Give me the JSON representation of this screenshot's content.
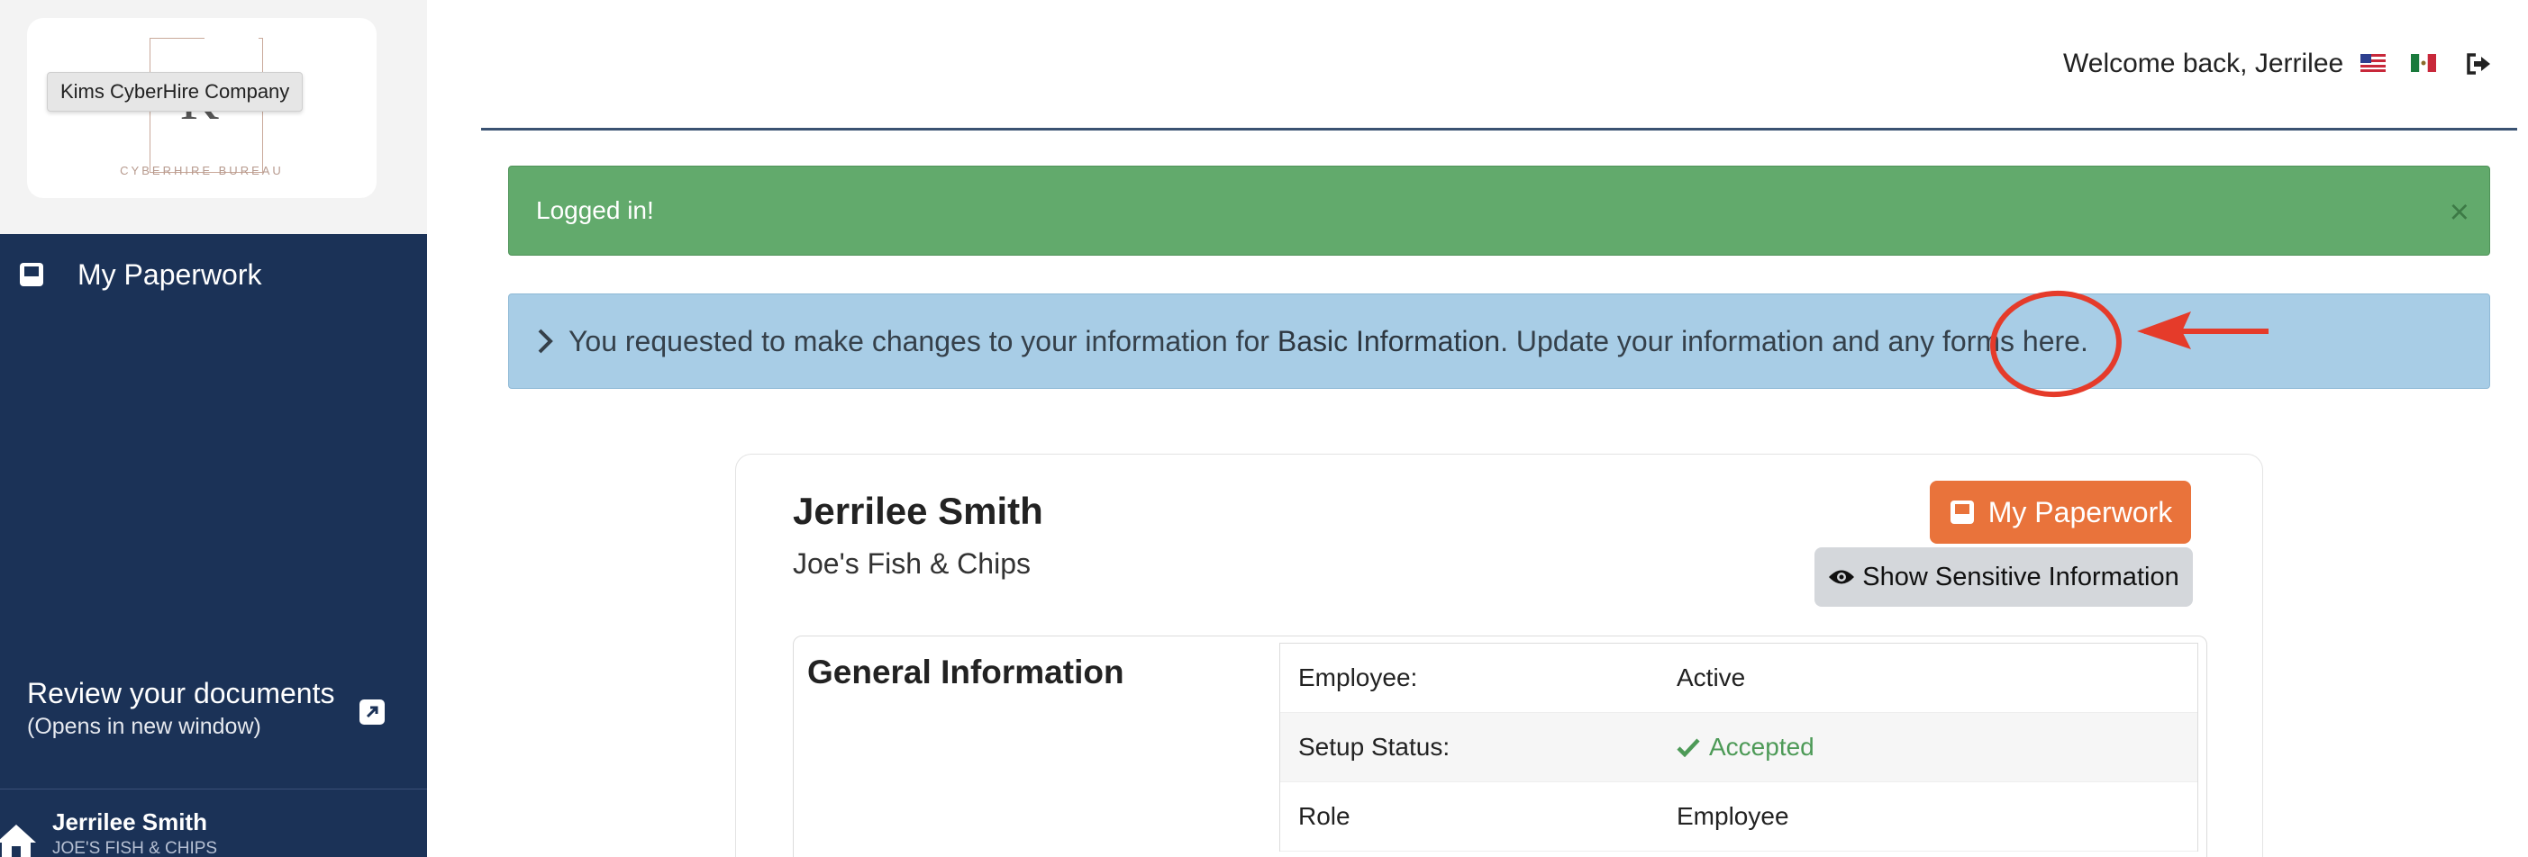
{
  "sidebar": {
    "logo_letter": "K",
    "logo_subtitle": "CYBERHIRE BUREAU",
    "logo_tooltip": "Kims CyberHire Company",
    "nav_items": [
      {
        "label": "My Paperwork",
        "icon": "inbox-icon"
      }
    ],
    "review": {
      "title": "Review your documents",
      "subtitle": "(Opens in new window)",
      "icon": "external-link-icon"
    },
    "user": {
      "name": "Jerrilee Smith",
      "company": "JOE'S FISH & CHIPS",
      "icon": "home-icon"
    }
  },
  "header": {
    "welcome": "Welcome back, Jerrilee",
    "languages": [
      "us-flag-icon",
      "mexico-flag-icon"
    ],
    "logout_icon": "sign-out-icon"
  },
  "alerts": {
    "success": {
      "text": "Logged in!",
      "close": "×"
    },
    "info": {
      "prefix": "You requested to make changes to your information for ",
      "section": "Basic Information",
      "middle": ". Update your information and any forms ",
      "link": "here",
      "suffix": "."
    }
  },
  "profile": {
    "name": "Jerrilee Smith",
    "company": "Joe's Fish & Chips",
    "paperwork_button": "My Paperwork",
    "sensitive_button": "Show Sensitive Information",
    "general_title": "General Information",
    "rows": [
      {
        "label": "Employee:",
        "value": "Active"
      },
      {
        "label": "Setup Status:",
        "value": "Accepted"
      },
      {
        "label": "Role",
        "value": "Employee"
      }
    ]
  },
  "colors": {
    "sidebar": "#1b3257",
    "success": "#62aa6c",
    "info": "#a8cde6",
    "accent": "#e9733b",
    "annotation": "#e53b2a"
  }
}
